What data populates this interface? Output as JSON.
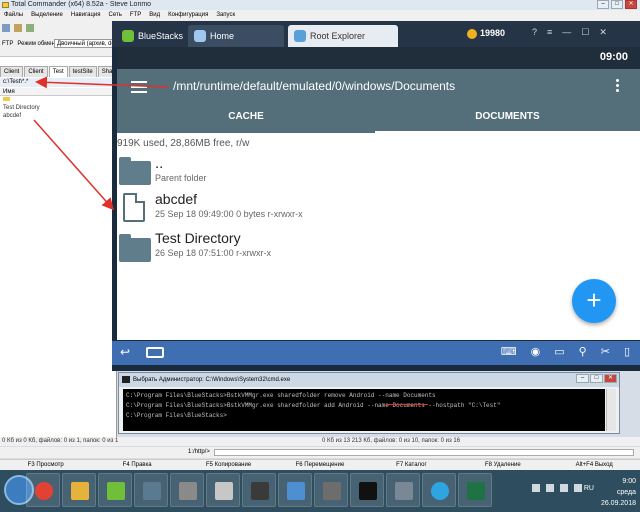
{
  "tc": {
    "title": "Total Commander (x64) 8.52a - Steve Lonmo",
    "menu": [
      "Файлы",
      "Выделение",
      "Навигация",
      "Сеть",
      "FTP",
      "Вид",
      "Конфигурация",
      "Запуск"
    ],
    "toolbar": {
      "ftp_label": "FTP",
      "mode_label": "Режим обмена",
      "mode_value": "Двоичный (архив, doc, р"
    },
    "tabs": [
      "Client",
      "Client",
      "Test",
      "testSite",
      "SharedF"
    ],
    "path": "c:\\Test\\*.*",
    "column_name": "Имя",
    "files": [
      "Test Directory",
      "abcdef"
    ],
    "status_left": "0 Кб из 0 Кб, файлов: 0 из 1, папок: 0 из 1",
    "status_right": "0 Кб из 13 213 Кб, файлов: 0 из 10, папок: 0 из 16",
    "cmdline": "1:/http/>",
    "fkeys": [
      "F3 Просмотр",
      "F4 Правка",
      "F5 Копирование",
      "F6 Перемещение",
      "F7 Каталог",
      "F8 Удаление",
      "Alt+F4 Выход"
    ]
  },
  "bluestacks": {
    "app_name": "BlueStacks",
    "tabs": [
      "Home",
      "Root Explorer"
    ],
    "coins": "19980",
    "controls": [
      "?",
      "≡",
      "—",
      "☐",
      "✕"
    ]
  },
  "android": {
    "time": "09:00",
    "path": "/mnt/runtime/default/emulated/0/windows/Documents",
    "tabs": [
      "CACHE",
      "DOCUMENTS"
    ],
    "storage": "919K used, 28,86MB free, r/w",
    "items": [
      {
        "name": "..",
        "meta": "Parent folder",
        "type": "folder"
      },
      {
        "name": "abcdef",
        "meta": "25 Sep 18 09:49:00  0 bytes  r-xrwxr-x",
        "type": "file"
      },
      {
        "name": "Test Directory",
        "meta": "26 Sep 18 07:51:00   r-xrwxr-x",
        "type": "folder"
      }
    ],
    "fab": "+"
  },
  "cmd": {
    "title": "Выбрать Администратор: C:\\Windows\\System32\\cmd.exe",
    "lines": [
      "C:\\Program Files\\BlueStacks>BstkVMMgr.exe sharedfolder remove Android --name Documents",
      "C:\\Program Files\\BlueStacks>BstkVMMgr.exe sharedfolder add Android --name Documents --hostpath \"C:\\Test\"",
      "C:\\Program Files\\BlueStacks>"
    ]
  },
  "taskbar": {
    "time": "9:00",
    "day": "среда",
    "date": "26.09.2018",
    "lang": "RU"
  },
  "colors": {
    "appbar": "#546e7a",
    "fab": "#2196f3",
    "bs_nav": "#3f6fb2",
    "arrow": "#e0302a"
  }
}
